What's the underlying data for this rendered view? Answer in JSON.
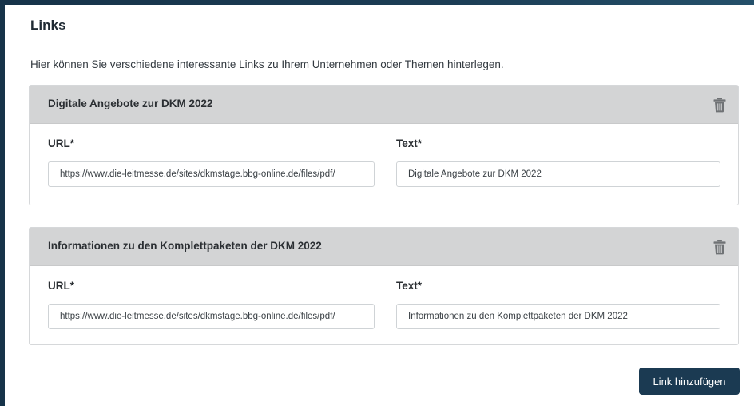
{
  "section": {
    "title": "Links",
    "intro": "Hier können Sie verschiedene interessante Links zu Ihrem Unternehmen oder Themen hinterlegen."
  },
  "links": [
    {
      "header": "Digitale Angebote zur DKM 2022",
      "delete_icon": "trash-icon",
      "url_label": "URL*",
      "url_value": "https://www.die-leitmesse.de/sites/dkmstage.bbg-online.de/files/pdf/",
      "text_label": "Text*",
      "text_value": "Digitale Angebote zur DKM 2022"
    },
    {
      "header": "Informationen zu den Komplettpaketen der DKM 2022",
      "delete_icon": "trash-icon",
      "url_label": "URL*",
      "url_value": "https://www.die-leitmesse.de/sites/dkmstage.bbg-online.de/files/pdf/",
      "text_label": "Text*",
      "text_value": "Informationen zu den Komplettpaketen der DKM 2022"
    }
  ],
  "actions": {
    "add_link_label": "Link hinzufügen"
  },
  "colors": {
    "primary": "#1b3a52",
    "card_header_bg": "#d3d4d5",
    "frame": "#163349"
  }
}
